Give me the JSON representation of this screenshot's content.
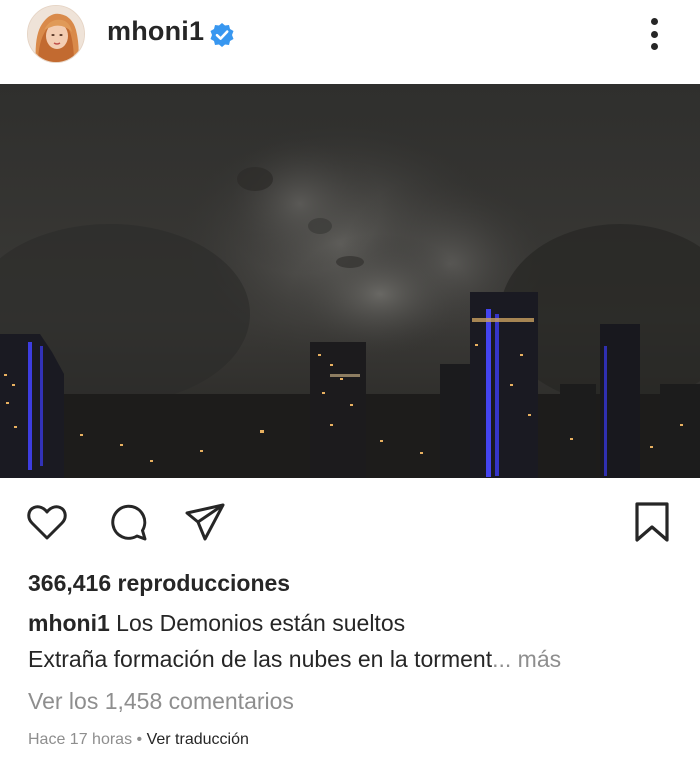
{
  "post": {
    "username": "mhoni1",
    "verified": true,
    "accent_color": "#3897f0"
  },
  "media": {
    "type": "video",
    "scene": "night-storm-city"
  },
  "actions": {
    "icons": [
      "heart-icon",
      "comment-icon",
      "share-icon",
      "bookmark-icon"
    ]
  },
  "stats": {
    "views": "366,416 reproducciones"
  },
  "caption": {
    "author": "mhoni1",
    "text": "Los Demonios están sueltos",
    "line2": "Extraña formación de las nubes en la torment",
    "ellipsis": "...",
    "more": "más"
  },
  "comments": {
    "label": "Ver los 1,458 comentarios"
  },
  "meta": {
    "time": "Hace 17 horas",
    "separator": "•",
    "translate": "Ver traducción"
  }
}
